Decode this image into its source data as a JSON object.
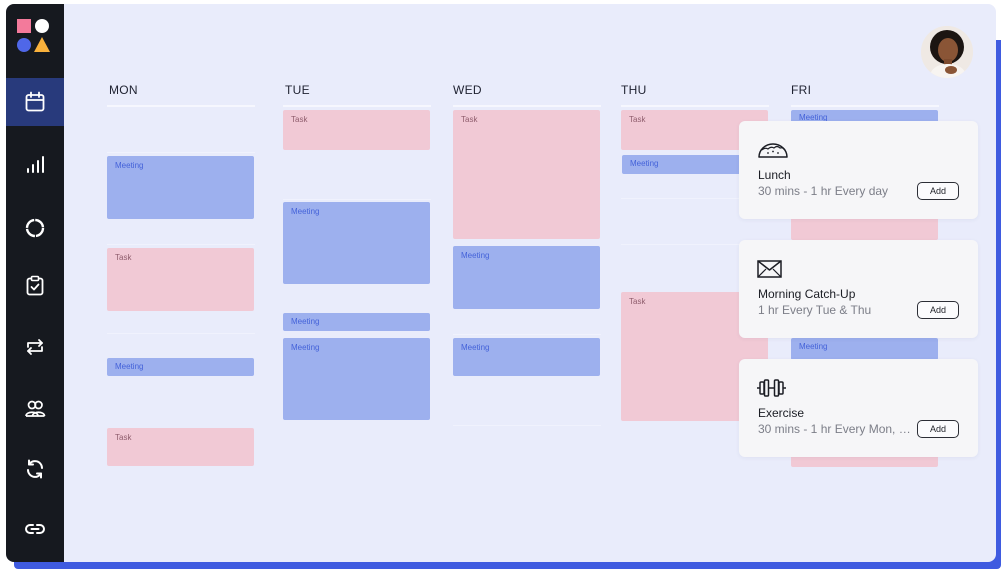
{
  "days": [
    "MON",
    "TUE",
    "WED",
    "THU",
    "FRI"
  ],
  "block_labels": {
    "task": "Task",
    "meeting": "Meeting"
  },
  "sidebar": {
    "items": [
      {
        "icon": "calendar-icon",
        "active": true
      },
      {
        "icon": "bar-chart-icon",
        "active": false
      },
      {
        "icon": "donut-chart-icon",
        "active": false
      },
      {
        "icon": "clipboard-check-icon",
        "active": false
      },
      {
        "icon": "swap-arrows-icon",
        "active": false
      },
      {
        "icon": "users-icon",
        "active": false
      },
      {
        "icon": "sync-icon",
        "active": false
      },
      {
        "icon": "link-icon",
        "active": false
      }
    ]
  },
  "habits": [
    {
      "icon": "taco-icon",
      "title": "Lunch",
      "subtitle": "30 mins - 1 hr Every day",
      "button": "Add"
    },
    {
      "icon": "envelope-icon",
      "title": "Morning Catch-Up",
      "subtitle": "1 hr Every Tue & Thu",
      "button": "Add"
    },
    {
      "icon": "dumbbell-icon",
      "title": "Exercise",
      "subtitle": "30 mins - 1 hr Every Mon, W...",
      "button": "Add"
    }
  ],
  "colors": {
    "sidebar": "#16191f",
    "sidebar_active": "#283a7c",
    "canvas": "#e9ecfb",
    "task": "#f1c9d5",
    "meeting": "#9db0ee",
    "accent": "#3f5be0"
  }
}
